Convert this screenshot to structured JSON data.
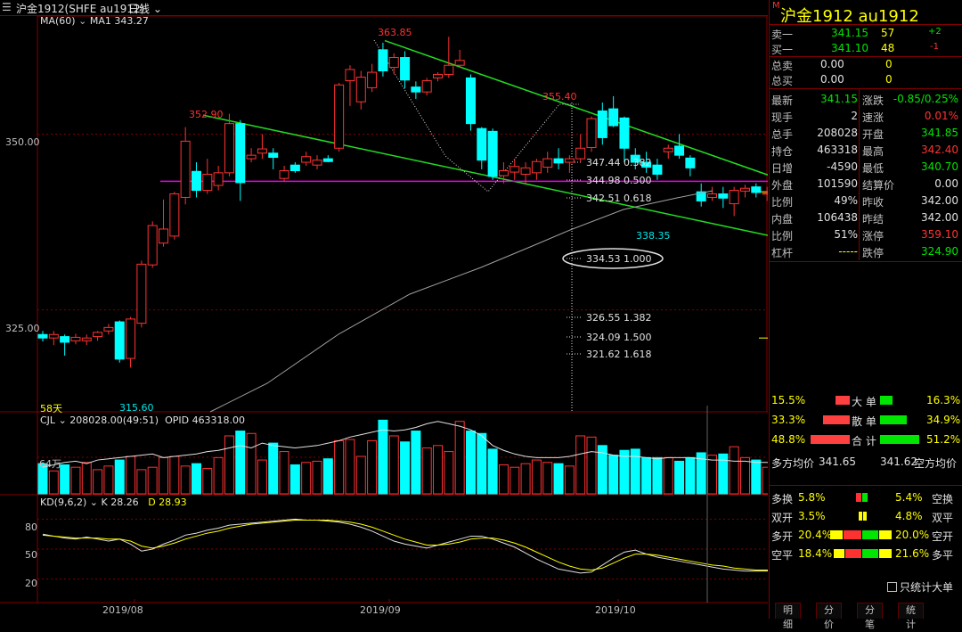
{
  "topbar": {
    "instrument": "沪金1912(SHFE au1912)",
    "period": "日线",
    "ma_label": "MA(60)",
    "ma_value": "MA1 343.27"
  },
  "price_axis": {
    "labels": [
      "350.00",
      "325.00"
    ]
  },
  "annotations": {
    "hi1": "352.90",
    "hi2": "363.85",
    "hi3": "355.40",
    "lo1": "315.60",
    "lo2": "338.35",
    "days": "58天",
    "fib": [
      "347.44  0.382",
      "344.98  0.500",
      "342.51  0.618",
      "334.53  1.000",
      "326.55  1.382",
      "324.09  1.500",
      "321.62  1.618"
    ]
  },
  "volume_panel": {
    "title": "CJL",
    "value": "208028.00(49:51)",
    "opid": "OPID 463318.00",
    "axis": "64万"
  },
  "kd_panel": {
    "title": "KD(9,6,2)",
    "k": "K 28.26",
    "d": "D 28.93",
    "axis": [
      "80",
      "50",
      "20"
    ]
  },
  "date_axis": [
    "2019/08",
    "2019/09",
    "2019/10"
  ],
  "side": {
    "badge": "M",
    "title": "沪金1912  au1912",
    "sell1": {
      "label": "卖一",
      "price": "341.15",
      "vol": "57",
      "chg": "+2"
    },
    "buy1": {
      "label": "买一",
      "price": "341.10",
      "vol": "48",
      "chg": "-1"
    },
    "total_sell": {
      "label": "总卖",
      "a": "0.00",
      "b": "0"
    },
    "total_buy": {
      "label": "总买",
      "a": "0.00",
      "b": "0"
    },
    "stats": [
      {
        "l1": "最新",
        "v1": "341.15",
        "c1": "grn",
        "l2": "涨跌",
        "v2": "-0.85/0.25%",
        "c2": "grn"
      },
      {
        "l1": "现手",
        "v1": "2",
        "c1": "wht",
        "l2": "速涨",
        "v2": "0.01%",
        "c2": "red"
      },
      {
        "l1": "总手",
        "v1": "208028",
        "c1": "wht",
        "l2": "开盘",
        "v2": "341.85",
        "c2": "grn"
      },
      {
        "l1": "持仓",
        "v1": "463318",
        "c1": "wht",
        "l2": "最高",
        "v2": "342.40",
        "c2": "red"
      },
      {
        "l1": "日增",
        "v1": "-4590",
        "c1": "wht",
        "l2": "最低",
        "v2": "340.70",
        "c2": "grn"
      },
      {
        "l1": "外盘",
        "v1": "101590",
        "c1": "wht",
        "l2": "结算价",
        "v2": "0.00",
        "c2": "wht"
      },
      {
        "l1": "比例",
        "v1": "49%",
        "c1": "wht",
        "l2": "昨收",
        "v2": "342.00",
        "c2": "wht"
      },
      {
        "l1": "内盘",
        "v1": "106438",
        "c1": "wht",
        "l2": "昨结",
        "v2": "342.00",
        "c2": "wht"
      },
      {
        "l1": "比例",
        "v1": "51%",
        "c1": "wht",
        "l2": "涨停",
        "v2": "359.10",
        "c2": "red"
      },
      {
        "l1": "杠杆",
        "v1": "-----",
        "c1": "yel",
        "l2": "跌停",
        "v2": "324.90",
        "c2": "grn"
      }
    ],
    "flow": [
      {
        "left": "15.5%",
        "mid": "大 单",
        "right": "16.3%"
      },
      {
        "left": "33.3%",
        "mid": "散 单",
        "right": "34.9%"
      },
      {
        "left": "48.8%",
        "mid": "合 计",
        "right": "51.2%"
      }
    ],
    "avg": {
      "l": "多方均价",
      "lv": "341.65",
      "rv": "341.62",
      "r": "空方均价"
    },
    "positions": [
      {
        "l": "多换",
        "lv": "5.8%",
        "rv": "5.4%",
        "r": "空换"
      },
      {
        "l": "双开",
        "lv": "3.5%",
        "rv": "4.8%",
        "r": "双平"
      },
      {
        "l": "多开",
        "lv": "20.4%",
        "rv": "20.0%",
        "r": "空开"
      },
      {
        "l": "空平",
        "lv": "18.4%",
        "rv": "21.6%",
        "r": "多平"
      }
    ],
    "big_only": "只统计大单"
  },
  "tabs": [
    "明细",
    "分价",
    "分笔",
    "统计"
  ],
  "chart_data": {
    "type": "candlestick",
    "ylim": [
      310.5,
      366.8
    ],
    "ma_label": "MA(60)",
    "candles": [
      [
        321.5,
        321.0,
        322.0,
        320.5
      ],
      [
        321.0,
        321.5,
        322.0,
        320.0
      ],
      [
        321.2,
        320.4,
        321.5,
        318.5
      ],
      [
        320.6,
        321.1,
        321.6,
        320.1
      ],
      [
        320.6,
        321.0,
        321.5,
        320.0
      ],
      [
        321.2,
        321.8,
        322.0,
        320.6
      ],
      [
        322.0,
        322.5,
        323.0,
        321.5
      ],
      [
        323.3,
        318.0,
        323.5,
        317.5
      ],
      [
        318.1,
        323.7,
        324.0,
        316.8
      ],
      [
        323.1,
        331.5,
        332.0,
        322.5
      ],
      [
        331.4,
        337.0,
        337.6,
        331.0
      ],
      [
        334.5,
        336.5,
        340.7,
        334.0
      ],
      [
        335.5,
        341.5,
        341.8,
        335.0
      ],
      [
        341.0,
        349.0,
        351.0,
        340.0
      ],
      [
        344.7,
        342.0,
        346.0,
        341.0
      ],
      [
        342.0,
        344.3,
        346.5,
        341.5
      ],
      [
        342.7,
        344.5,
        345.5,
        342.0
      ],
      [
        344.5,
        351.5,
        352.9,
        344.0
      ],
      [
        351.5,
        343.1,
        352.0,
        340.5
      ],
      [
        346.5,
        347.0,
        348.0,
        346.0
      ],
      [
        347.3,
        347.9,
        350.0,
        346.5
      ],
      [
        347.3,
        346.7,
        348.0,
        345.0
      ],
      [
        343.7,
        344.8,
        345.5,
        343.3
      ],
      [
        345.6,
        344.8,
        346.0,
        344.5
      ],
      [
        346.0,
        346.8,
        347.5,
        345.5
      ],
      [
        345.6,
        346.3,
        347.0,
        345.0
      ],
      [
        346.5,
        346.1,
        347.0,
        346.0
      ],
      [
        348.0,
        357.0,
        357.3,
        347.5
      ],
      [
        357.6,
        359.2,
        359.8,
        354.0
      ],
      [
        354.6,
        358.1,
        359.0,
        353.5
      ],
      [
        356.6,
        358.8,
        360.0,
        356.0
      ],
      [
        362.0,
        359.0,
        363.0,
        358.2
      ],
      [
        359.5,
        360.9,
        361.5,
        358.5
      ],
      [
        360.9,
        357.7,
        361.8,
        356.5
      ],
      [
        356.7,
        356.0,
        357.5,
        355.0
      ],
      [
        356.0,
        357.6,
        358.0,
        355.5
      ],
      [
        358.0,
        358.5,
        358.8,
        357.5
      ],
      [
        358.5,
        359.8,
        363.85,
        358.0
      ],
      [
        359.8,
        360.5,
        362.0,
        359.5
      ],
      [
        358.0,
        351.5,
        358.5,
        350.5
      ],
      [
        350.8,
        346.3,
        351.0,
        345.0
      ],
      [
        350.4,
        344.0,
        350.8,
        343.5
      ],
      [
        344.1,
        344.8,
        346.0,
        343.0
      ],
      [
        344.6,
        345.4,
        346.5,
        343.5
      ],
      [
        344.3,
        345.2,
        346.0,
        343.0
      ],
      [
        344.5,
        346.1,
        346.5,
        343.5
      ],
      [
        345.3,
        346.5,
        347.5,
        344.5
      ],
      [
        346.5,
        345.9,
        348.0,
        345.0
      ],
      [
        346.0,
        346.5,
        347.0,
        344.5
      ],
      [
        346.5,
        348.0,
        350.0,
        346.0
      ],
      [
        348.1,
        352.2,
        352.5,
        347.5
      ],
      [
        353.3,
        349.5,
        354.5,
        348.5
      ],
      [
        353.6,
        351.2,
        355.4,
        351.0
      ],
      [
        352.3,
        348.0,
        352.5,
        346.0
      ],
      [
        347.0,
        346.0,
        348.0,
        345.0
      ],
      [
        346.0,
        345.3,
        347.5,
        344.5
      ],
      [
        345.6,
        344.3,
        346.5,
        343.5
      ],
      [
        347.5,
        348.0,
        348.5,
        346.5
      ],
      [
        348.3,
        347.0,
        350.0,
        346.5
      ],
      [
        346.6,
        345.2,
        347.0,
        344.0
      ],
      [
        341.8,
        340.5,
        343.0,
        339.7
      ],
      [
        341.0,
        341.5,
        342.5,
        340.5
      ],
      [
        341.5,
        340.9,
        342.5,
        339.5
      ],
      [
        340.1,
        342.0,
        342.5,
        338.35
      ],
      [
        341.9,
        342.3,
        342.8,
        341.0
      ],
      [
        342.5,
        341.7,
        343.0,
        341.0
      ],
      [
        341.6,
        341.6,
        342.5,
        340.5
      ],
      [
        341.85,
        341.15,
        342.4,
        340.7
      ]
    ],
    "volume": [
      25,
      19,
      24,
      22,
      26,
      20,
      23,
      28,
      31,
      20,
      22,
      30,
      31,
      23,
      25,
      21,
      30,
      48,
      52,
      50,
      28,
      42,
      35,
      24,
      26,
      27,
      29,
      44,
      45,
      31,
      44,
      61,
      48,
      43,
      52,
      38,
      40,
      35,
      60,
      52,
      50,
      37,
      24,
      22,
      25,
      28,
      26,
      25,
      23,
      48,
      47,
      40,
      32,
      36,
      37,
      30,
      30,
      30,
      27,
      30,
      34,
      32,
      33,
      39,
      30,
      28,
      22,
      20
    ],
    "opi": [
      22,
      24,
      26,
      27,
      25,
      28,
      29,
      30,
      31,
      32,
      33,
      30,
      31,
      32,
      33,
      35,
      36,
      38,
      40,
      38,
      42,
      40,
      39,
      38,
      39,
      40,
      42,
      44,
      47,
      49,
      51,
      53,
      52,
      53,
      55,
      58,
      60,
      58,
      56,
      53,
      48,
      40,
      36,
      33,
      31,
      30,
      30,
      30,
      31,
      33,
      35,
      34,
      32,
      31,
      31,
      30,
      29,
      30,
      30,
      30,
      29,
      28,
      28,
      27,
      27,
      26,
      26,
      25
    ],
    "k": [
      65,
      63,
      61,
      60,
      62,
      60,
      58,
      60,
      55,
      48,
      50,
      55,
      59,
      64,
      66,
      69,
      71,
      74,
      75,
      76,
      77,
      78,
      79,
      80,
      79,
      79,
      78,
      77,
      75,
      72,
      68,
      63,
      58,
      55,
      53,
      51,
      54,
      57,
      60,
      63,
      63,
      60,
      56,
      52,
      46,
      40,
      35,
      30,
      28,
      26,
      27,
      34,
      41,
      47,
      49,
      45,
      42,
      40,
      38,
      36,
      34,
      32,
      30,
      29,
      28,
      28,
      28,
      28.3
    ],
    "d": [
      64,
      63,
      62,
      61,
      61,
      61,
      60,
      60,
      58,
      53,
      51,
      53,
      56,
      60,
      63,
      66,
      68,
      71,
      73,
      75,
      76,
      77,
      78,
      79,
      79,
      79,
      79,
      78,
      77,
      75,
      72,
      68,
      64,
      60,
      57,
      54,
      54,
      55,
      57,
      60,
      61,
      61,
      59,
      56,
      52,
      47,
      42,
      37,
      33,
      30,
      29,
      31,
      36,
      41,
      45,
      45,
      44,
      42,
      40,
      38,
      36,
      34,
      33,
      31,
      30,
      29,
      29,
      28.9
    ]
  }
}
